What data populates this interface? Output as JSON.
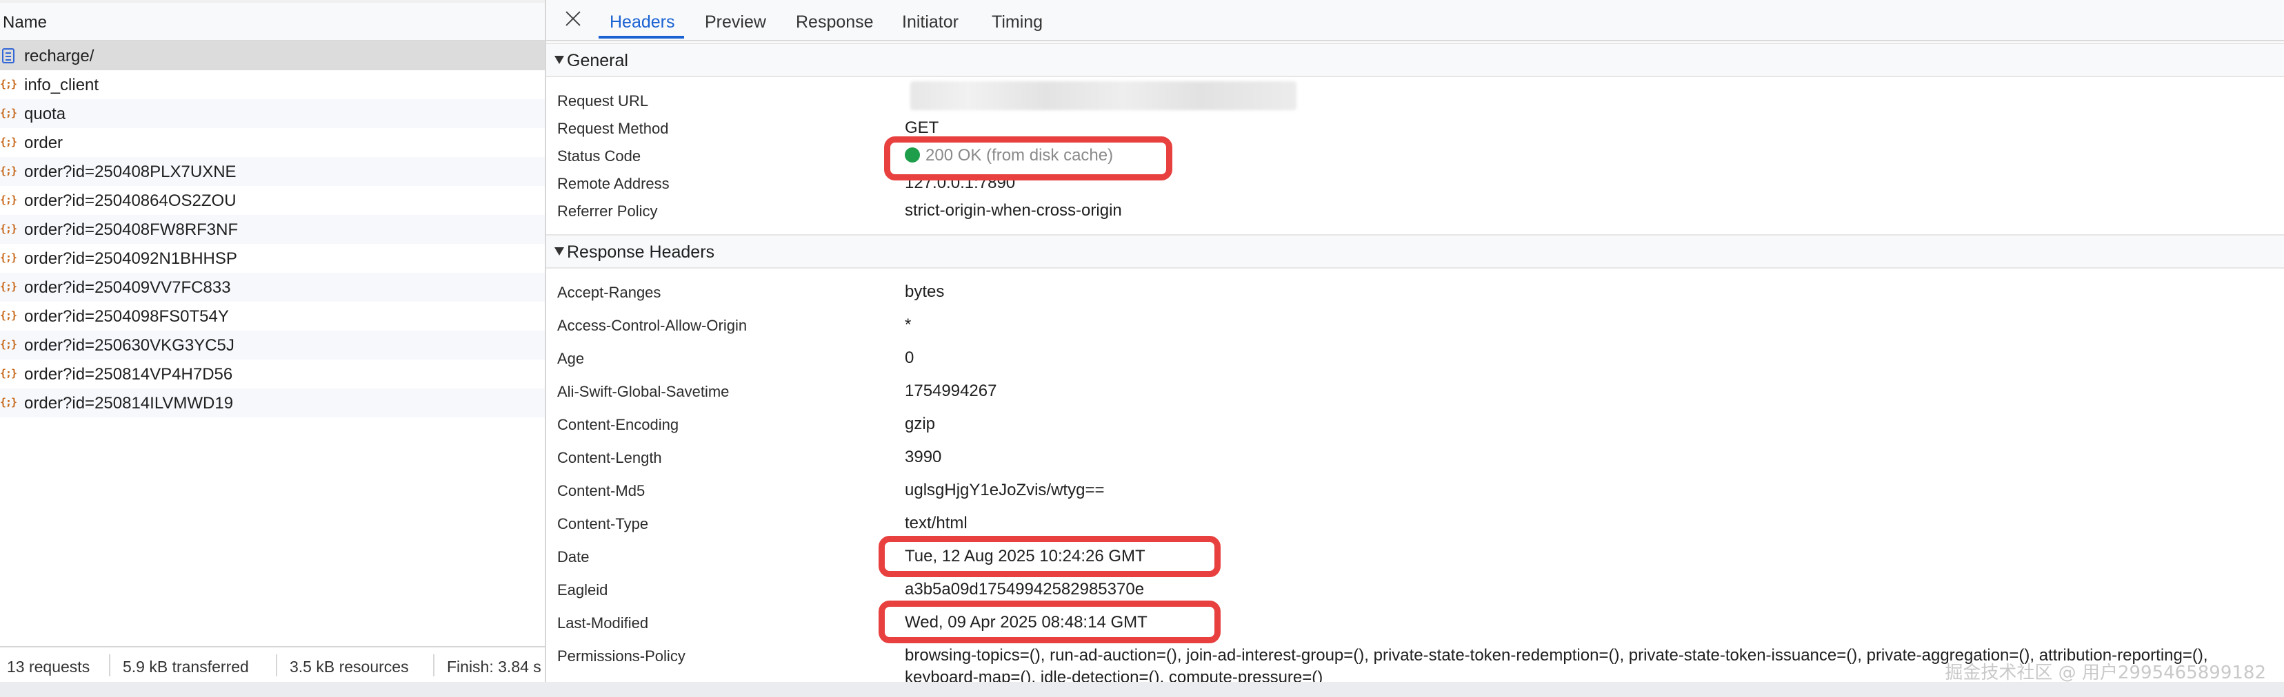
{
  "requests_panel": {
    "column_header": "Name",
    "requests": [
      {
        "name": "recharge/",
        "type": "document"
      },
      {
        "name": "info_client",
        "type": "xhr"
      },
      {
        "name": "quota",
        "type": "xhr"
      },
      {
        "name": "order",
        "type": "xhr"
      },
      {
        "name": "order?id=250408PLX7UXNE",
        "type": "xhr"
      },
      {
        "name": "order?id=25040864OS2ZOU",
        "type": "xhr"
      },
      {
        "name": "order?id=250408FW8RF3NF",
        "type": "xhr"
      },
      {
        "name": "order?id=2504092N1BHHSP",
        "type": "xhr"
      },
      {
        "name": "order?id=250409VV7FC833",
        "type": "xhr"
      },
      {
        "name": "order?id=2504098FS0T54Y",
        "type": "xhr"
      },
      {
        "name": "order?id=250630VKG3YC5J",
        "type": "xhr"
      },
      {
        "name": "order?id=250814VP4H7D56",
        "type": "xhr"
      },
      {
        "name": "order?id=250814ILVMWD19",
        "type": "xhr"
      }
    ],
    "xhr_icon_glyph": "{;}",
    "status": {
      "requests": "13 requests",
      "transferred": "5.9 kB transferred",
      "resources": "3.5 kB resources",
      "finish": "Finish: 3.84 s"
    }
  },
  "detail_panel": {
    "tabs": {
      "headers": "Headers",
      "preview": "Preview",
      "response": "Response",
      "initiator": "Initiator",
      "timing": "Timing"
    },
    "active_tab": "Headers",
    "general": {
      "title": "General",
      "request_url_label": "Request URL",
      "request_method_label": "Request Method",
      "request_method": "GET",
      "status_code_label": "Status Code",
      "status_code": "200 OK (from disk cache)",
      "remote_address_label": "Remote Address",
      "remote_address": "127.0.0.1:7890",
      "referrer_policy_label": "Referrer Policy",
      "referrer_policy": "strict-origin-when-cross-origin"
    },
    "response_headers": {
      "title": "Response Headers",
      "items": [
        {
          "key": "Accept-Ranges",
          "value": "bytes"
        },
        {
          "key": "Access-Control-Allow-Origin",
          "value": "*"
        },
        {
          "key": "Age",
          "value": "0"
        },
        {
          "key": "Ali-Swift-Global-Savetime",
          "value": "1754994267"
        },
        {
          "key": "Content-Encoding",
          "value": "gzip"
        },
        {
          "key": "Content-Length",
          "value": "3990"
        },
        {
          "key": "Content-Md5",
          "value": "uglsgHjgY1eJoZvis/wtyg=="
        },
        {
          "key": "Content-Type",
          "value": "text/html"
        },
        {
          "key": "Date",
          "value": "Tue, 12 Aug 2025 10:24:26 GMT"
        },
        {
          "key": "Eagleid",
          "value": "a3b5a09d17549942582985370e"
        },
        {
          "key": "Last-Modified",
          "value": "Wed, 09 Apr 2025 08:48:14 GMT"
        },
        {
          "key": "Permissions-Policy",
          "value": "browsing-topics=(), run-ad-auction=(), join-ad-interest-group=(), private-state-token-redemption=(), private-state-token-issuance=(), private-aggregation=(), attribution-reporting=(), keyboard-map=(), idle-detection=(), compute-pressure=()"
        }
      ]
    }
  },
  "colors": {
    "accent_blue": "#1a62d2",
    "status_green": "#1e9e4a",
    "highlight_red": "#e8403f"
  },
  "watermark": "掘金技术社区 @ 用户2995465899182"
}
